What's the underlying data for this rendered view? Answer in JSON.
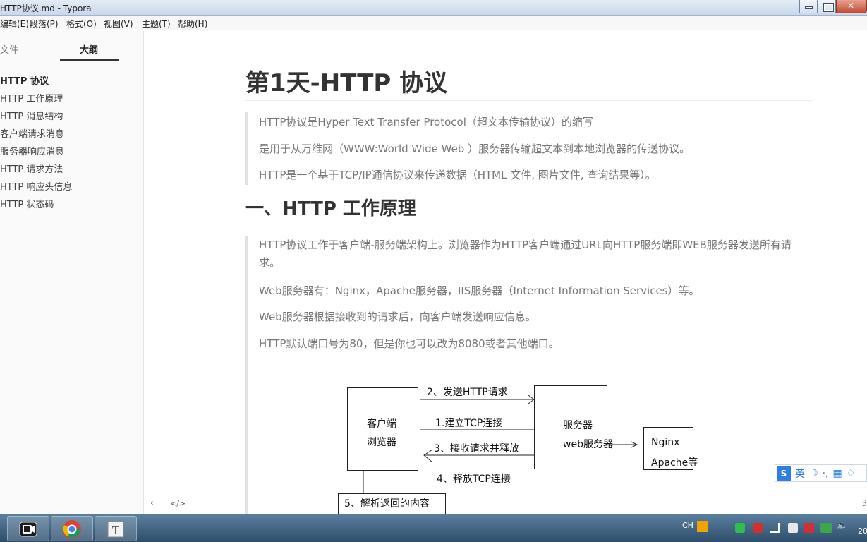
{
  "window": {
    "title": "HTTP协议.md - Typora"
  },
  "menu": [
    "编辑(E)",
    "段落(P)",
    "格式(O)",
    "视图(V)",
    "主题(T)",
    "帮助(H)"
  ],
  "sidebar": {
    "tabs": [
      "文件",
      "大纲"
    ],
    "active_tab": "大纲",
    "outline": [
      "HTTP 协议",
      "HTTP 工作原理",
      "HTTP 消息结构",
      "客户端请求消息",
      "服务器响应消息",
      "HTTP 请求方法",
      "HTTP 响应头信息",
      "HTTP 状态码"
    ]
  },
  "doc": {
    "h1": "第1天-HTTP 协议",
    "intro": [
      "HTTP协议是Hyper Text Transfer Protocol（超文本传输协议）的缩写",
      "是用于从万维网（WWW:World Wide Web ）服务器传输超文本到本地浏览器的传送协议。",
      "HTTP是一个基于TCP/IP通信协议来传递数据（HTML 文件, 图片文件, 查询结果等）。"
    ],
    "h2": "一、HTTP 工作原理",
    "section": [
      "HTTP协议工作于客户端-服务端架构上。浏览器作为HTTP客户端通过URL向HTTP服务端即WEB服务器发送所有请求。",
      "Web服务器有：Nginx，Apache服务器，IIS服务器（Internet Information Services）等。",
      "Web服务器根据接收到的请求后，向客户端发送响应信息。",
      "HTTP默认端口号为80，但是你也可以改为8080或者其他端口。"
    ],
    "diagram": {
      "client_line1": "客户端",
      "client_line2": "浏览器",
      "server_line1": "服务器",
      "server_line2": "web服务器",
      "nginx_line1": "Nginx",
      "nginx_line2": "Apache等",
      "step2": "2、发送HTTP请求",
      "step1": "1.建立TCP连接",
      "step3": "3、接收请求并释放",
      "step4": "4、释放TCP连接",
      "step5": "5、解析返回的内容"
    }
  },
  "footer": {
    "prev_icon": "‹",
    "source_icon": "</>",
    "word_count": "3"
  },
  "ime": {
    "logo": "S",
    "mode": "英",
    "icons": [
      "moon-icon",
      "punct-icon",
      "keyboard-icon",
      "shirt-icon"
    ]
  },
  "tray": {
    "lang": "CH",
    "clock": "20"
  },
  "colors": {
    "accent": "#333333",
    "quote_bar": "#dfe2e5",
    "quote_text": "#777777"
  }
}
